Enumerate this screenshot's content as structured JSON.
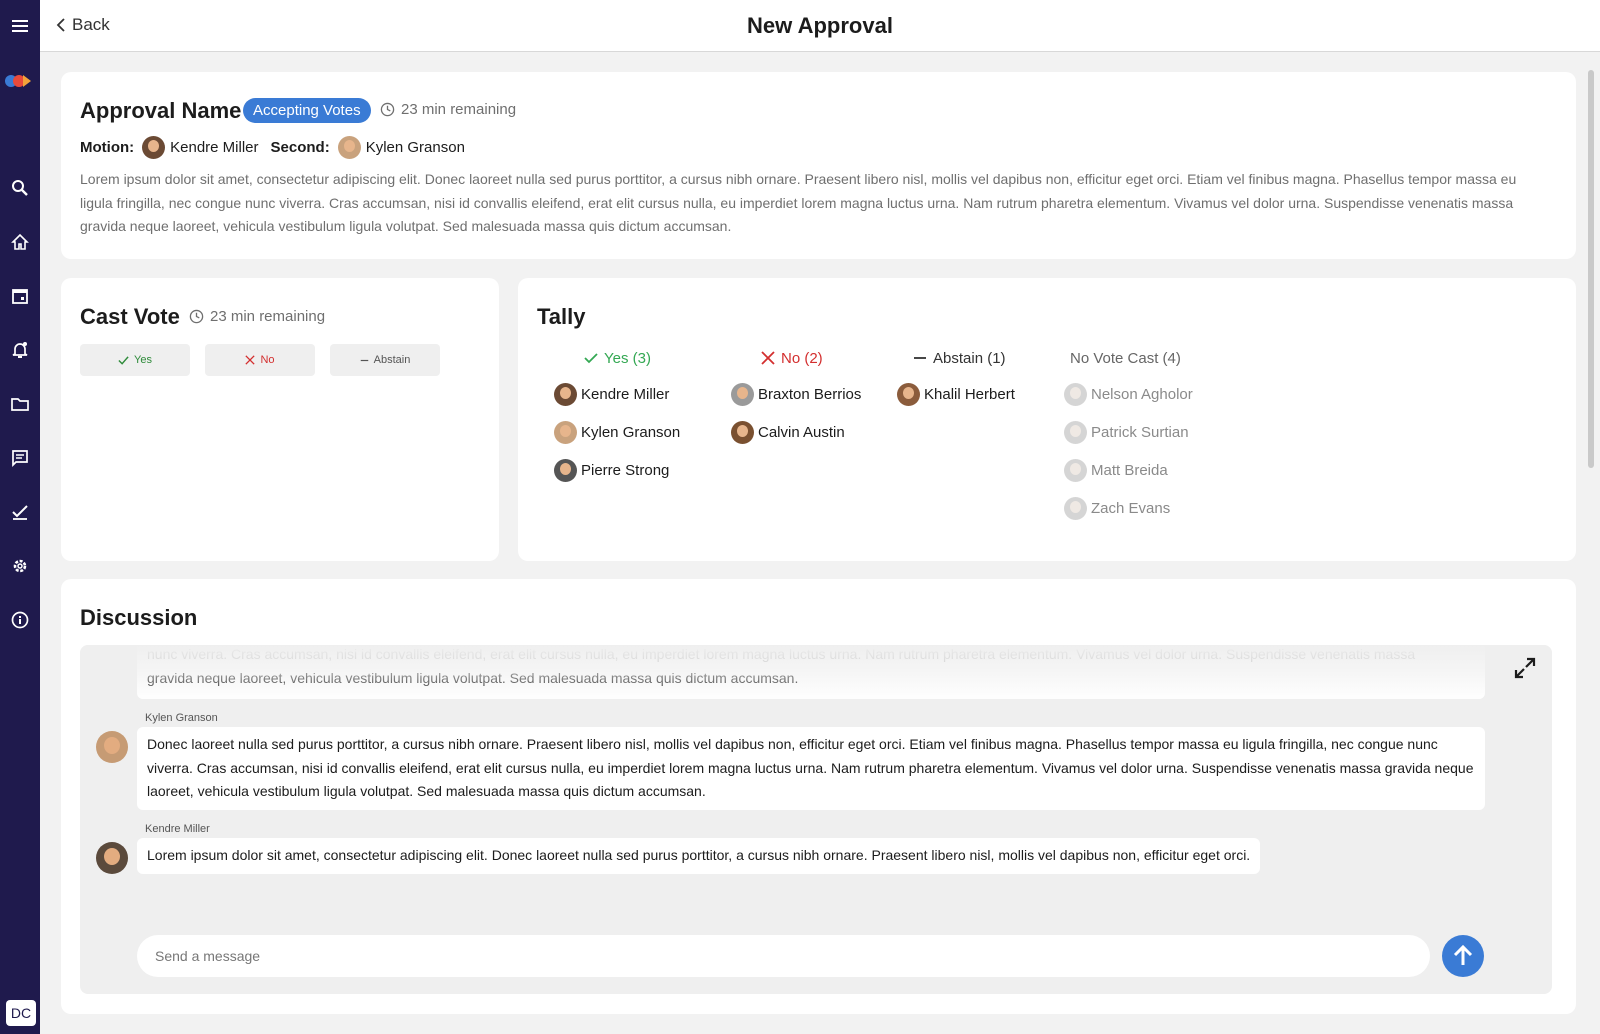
{
  "header": {
    "back_label": "Back",
    "title": "New Approval"
  },
  "sidebar": {
    "items": [
      {
        "icon": "menu-icon"
      },
      {
        "icon": "search-icon"
      },
      {
        "icon": "home-icon"
      },
      {
        "icon": "calendar-icon"
      },
      {
        "icon": "bell-icon"
      },
      {
        "icon": "folder-icon"
      },
      {
        "icon": "chat-icon"
      },
      {
        "icon": "check-icon"
      },
      {
        "icon": "gear-icon"
      },
      {
        "icon": "info-icon"
      }
    ],
    "user_initials": "DC"
  },
  "approval": {
    "title": "Approval Name",
    "status": "Accepting Votes",
    "time_remaining": "23 min remaining",
    "motion_label": "Motion:",
    "motion_name": "Kendre Miller",
    "second_label": "Second:",
    "second_name": "Kylen Granson",
    "description": "Lorem ipsum dolor sit amet, consectetur adipiscing elit. Donec laoreet nulla sed purus porttitor, a cursus nibh ornare. Praesent libero nisl, mollis vel dapibus non, efficitur eget orci. Etiam vel finibus magna. Phasellus tempor massa eu ligula fringilla, nec congue nunc viverra. Cras accumsan, nisi id convallis eleifend, erat elit cursus nulla, eu imperdiet lorem magna luctus urna. Nam rutrum pharetra elementum. Vivamus vel dolor urna. Suspendisse venenatis massa gravida neque laoreet, vehicula vestibulum ligula volutpat. Sed malesuada massa quis dictum accumsan."
  },
  "cast_vote": {
    "title": "Cast Vote",
    "time_remaining": "23 min remaining",
    "yes_label": "Yes",
    "no_label": "No",
    "abstain_label": "Abstain"
  },
  "tally": {
    "title": "Tally",
    "yes": {
      "label": "Yes (3)",
      "names": [
        "Kendre Miller",
        "Kylen Granson",
        "Pierre Strong"
      ]
    },
    "no": {
      "label": "No (2)",
      "names": [
        "Braxton Berrios",
        "Calvin Austin"
      ]
    },
    "abstain": {
      "label": "Abstain (1)",
      "names": [
        "Khalil Herbert"
      ]
    },
    "no_vote": {
      "label": "No Vote Cast (4)",
      "names": [
        "Nelson Agholor",
        "Patrick Surtian",
        "Matt Breida",
        "Zach Evans"
      ]
    }
  },
  "discussion": {
    "title": "Discussion",
    "messages": [
      {
        "text_partial_line1": "nunc viverra. Cras accumsan, nisi id convallis eleifend, erat elit cursus nulla, eu imperdiet lorem magna luctus urna. Nam rutrum pharetra elementum. Vivamus vel dolor urna. Suspendisse venenatis massa",
        "text_partial_line2": "gravida neque laoreet, vehicula vestibulum ligula volutpat. Sed malesuada massa quis dictum accumsan."
      },
      {
        "author": "Kylen Granson",
        "text": "Donec laoreet nulla sed purus porttitor, a cursus nibh ornare. Praesent libero nisl, mollis vel dapibus non, efficitur eget orci. Etiam vel finibus magna. Phasellus tempor massa eu ligula fringilla, nec congue nunc viverra. Cras accumsan, nisi id convallis eleifend, erat elit cursus nulla, eu imperdiet lorem magna luctus urna. Nam rutrum pharetra elementum. Vivamus vel dolor urna. Suspendisse venenatis massa gravida neque laoreet, vehicula vestibulum ligula volutpat. Sed malesuada massa quis dictum accumsan."
      },
      {
        "author": "Kendre Miller",
        "text": "Lorem ipsum dolor sit amet, consectetur adipiscing elit. Donec laoreet nulla sed purus porttitor, a cursus nibh ornare. Praesent libero nisl, mollis vel dapibus non, efficitur eget orci."
      }
    ],
    "input_placeholder": "Send a message"
  },
  "colors": {
    "sidebar": "#1f1a4d",
    "accent": "#3a7bd5",
    "yes": "#34a853",
    "no": "#d32f2f"
  }
}
